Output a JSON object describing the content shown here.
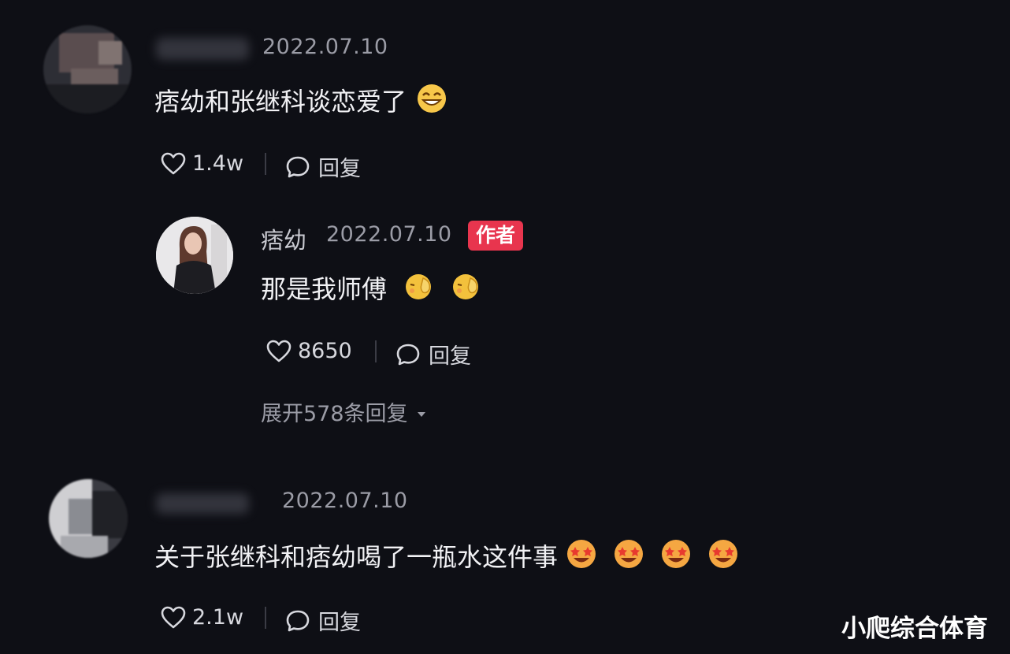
{
  "comments": [
    {
      "date": "2022.07.10",
      "text": "痞幼和张继科谈恋爱了",
      "likes": "1.4w",
      "reply_label": "回复"
    },
    {
      "date": "2022.07.10",
      "text": "关于张继科和痞幼喝了一瓶水这件事",
      "likes": "2.1w",
      "reply_label": "回复"
    }
  ],
  "author_reply": {
    "name": "痞幼",
    "date": "2022.07.10",
    "badge": "作者",
    "text": "那是我师傅",
    "likes": "8650",
    "reply_label": "回复",
    "expand_label": "展开578条回复"
  },
  "watermark": "小爬综合体育",
  "icons": {
    "like": "heart-outline-icon",
    "reply": "speech-bubble-icon",
    "expand": "caret-down-icon",
    "emoji_grin": "grinning-emoji",
    "emoji_shy": "shy-face-emoji",
    "emoji_starstruck": "heart-eyes-emoji"
  },
  "colors": {
    "background": "#0e0f15",
    "author_badge": "#e8354e",
    "muted_text": "#9b9ca6"
  }
}
